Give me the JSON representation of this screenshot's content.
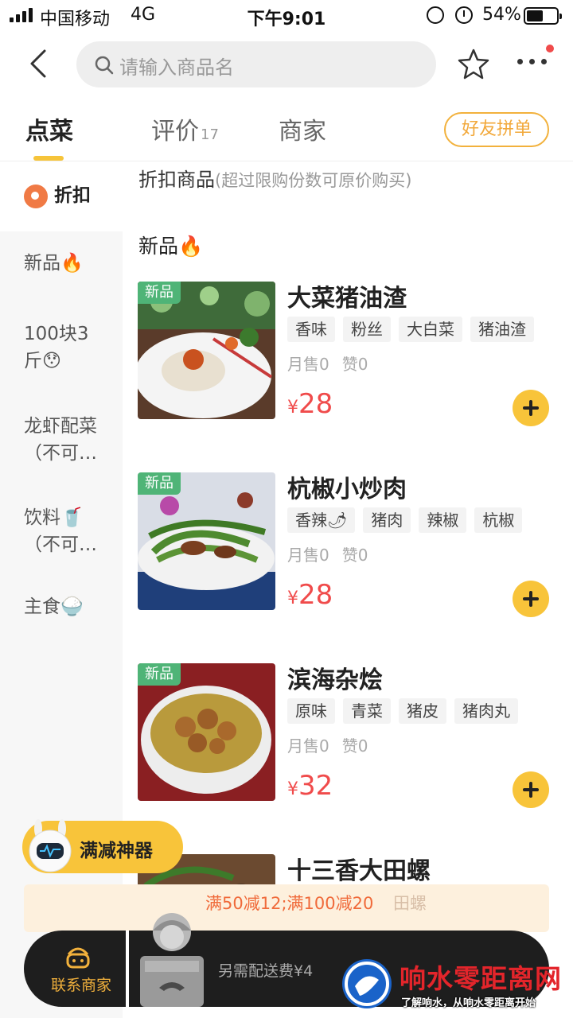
{
  "status_bar": {
    "carrier": "中国移动",
    "network": "4G",
    "time": "下午9:01",
    "battery": "54%"
  },
  "header": {
    "search_placeholder": "请输入商品名"
  },
  "tabs": [
    {
      "label": "点菜"
    },
    {
      "label": "评价",
      "count": "17"
    },
    {
      "label": "商家"
    }
  ],
  "group_order_label": "好友拼单",
  "sidebar": {
    "items": [
      {
        "label": "折扣"
      },
      {
        "label": "新品🔥"
      },
      {
        "label": "100块3斤😯"
      },
      {
        "label": "龙虾配菜（不可…"
      },
      {
        "label": "饮料🥤（不可…"
      },
      {
        "label": "主食🍚"
      }
    ]
  },
  "notice": {
    "title": "折扣商品",
    "sub": "(超过限购份数可原价购买)"
  },
  "section_title": "新品🔥",
  "badge_new": "新品",
  "products": [
    {
      "name": "大菜猪油渣",
      "tags": [
        "香味",
        "粉丝",
        "大白菜",
        "猪油渣"
      ],
      "sales": "月售0",
      "likes": "赞0",
      "currency": "¥",
      "price": "28"
    },
    {
      "name": "杭椒小炒肉",
      "tags": [
        "香辣🌶",
        "猪肉",
        "辣椒",
        "杭椒"
      ],
      "sales": "月售0",
      "likes": "赞0",
      "currency": "¥",
      "price": "28"
    },
    {
      "name": "滨海杂烩",
      "tags": [
        "原味",
        "青菜",
        "猪皮",
        "猪肉丸"
      ],
      "sales": "月售0",
      "likes": "赞0",
      "currency": "¥",
      "price": "32"
    },
    {
      "name": "十三香大田螺"
    }
  ],
  "promo": {
    "text": "满50减12;满100减20",
    "faded": "田螺"
  },
  "helper_label": "满减神器",
  "bottom_bar": {
    "contact_label": "联系商家",
    "delivery_fee": "另需配送费¥4"
  },
  "watermark": {
    "title": "响水零距离网",
    "sub": "了解响水，从响水零距离开始"
  },
  "colors": {
    "accent": "#f8c43a",
    "price": "#f04b4b",
    "badge": "#4fb477"
  }
}
